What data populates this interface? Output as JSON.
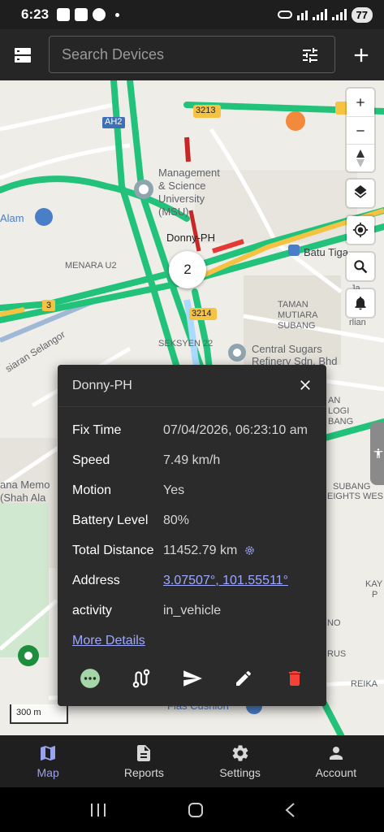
{
  "status_bar": {
    "time": "6:23",
    "battery": "77"
  },
  "app_bar": {
    "search_placeholder": "Search Devices"
  },
  "map": {
    "labels": {
      "road_3213": "3213",
      "road_ah2": "AH2",
      "road_3214": "3214",
      "road_3": "3",
      "msu_1": "Management",
      "msu_2": "& Science",
      "msu_3": "University",
      "msu_4": "(MSU)",
      "alam": "Alam",
      "menara": "MENARA U2",
      "batu_tiga": "Batu Tiga",
      "tamanmutiara_1": "TAMAN",
      "tamanmutiara_2": "MUTIARA",
      "tamanmutiara_3": "SUBANG",
      "seksyen": "SEKSYEN 22",
      "central_1": "Central Sugars",
      "central_2": "Refinery Sdn. Bhd",
      "persiaran": "siaran Selangor",
      "memorial_1": "ana Memo",
      "memorial_2": "(Shah Ala",
      "jalan": "Ja",
      "irlan": "rlian",
      "right_an": "AN",
      "right_logi": "LOGI",
      "right_bang": "BANG",
      "right_subang": "SUBANG",
      "right_heights": "EIGHTS WES",
      "right_kay": "KAY",
      "right_p": "P",
      "right_no": "NO",
      "right_rus": "RUS",
      "right_reika": "REIKA",
      "fiascushion": "Flas Cushion"
    },
    "device_label": "Donny-PH",
    "cluster_count": "2",
    "scale": "300 m"
  },
  "popup": {
    "title": "Donny-PH",
    "rows": [
      {
        "key": "Fix Time",
        "value": "07/04/2026, 06:23:10 am"
      },
      {
        "key": "Speed",
        "value": "7.49 km/h"
      },
      {
        "key": "Motion",
        "value": "Yes"
      },
      {
        "key": "Battery Level",
        "value": "80%"
      },
      {
        "key": "Total Distance",
        "value": "11452.79 km"
      },
      {
        "key": "Address",
        "value": "3.07507°, 101.55511°"
      },
      {
        "key": "activity",
        "value": "in_vehicle"
      }
    ],
    "more_details": "More Details",
    "colors": {
      "more_icon": "#a5d6a7",
      "delete_icon": "#f44336"
    }
  },
  "bottom_nav": [
    {
      "label": "Map",
      "icon": "map-icon",
      "active": true
    },
    {
      "label": "Reports",
      "icon": "description-icon",
      "active": false
    },
    {
      "label": "Settings",
      "icon": "gear-icon",
      "active": false
    },
    {
      "label": "Account",
      "icon": "person-icon",
      "active": false
    }
  ]
}
